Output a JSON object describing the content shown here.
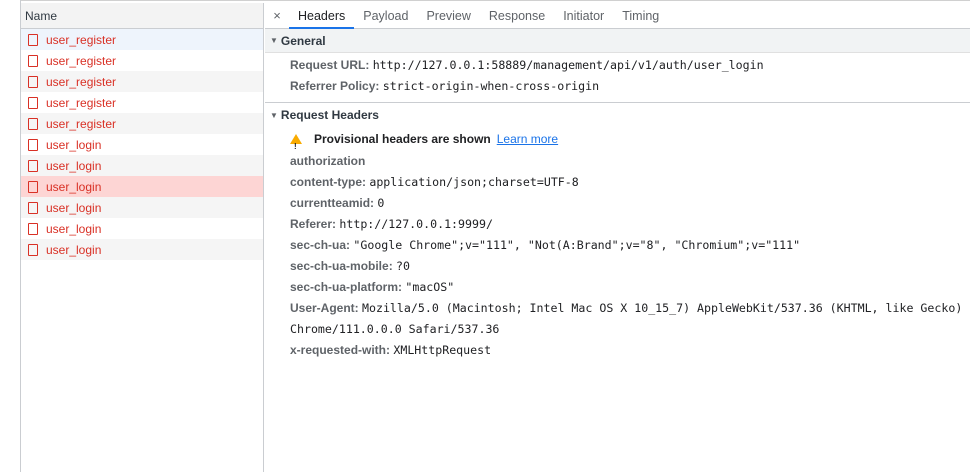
{
  "request_list": {
    "header": "Name",
    "items": [
      {
        "label": "user_register",
        "state": "first"
      },
      {
        "label": "user_register",
        "state": "normal"
      },
      {
        "label": "user_register",
        "state": "alt"
      },
      {
        "label": "user_register",
        "state": "normal"
      },
      {
        "label": "user_register",
        "state": "alt"
      },
      {
        "label": "user_login",
        "state": "normal"
      },
      {
        "label": "user_login",
        "state": "alt"
      },
      {
        "label": "user_login",
        "state": "selected"
      },
      {
        "label": "user_login",
        "state": "alt"
      },
      {
        "label": "user_login",
        "state": "normal"
      },
      {
        "label": "user_login",
        "state": "alt"
      }
    ]
  },
  "tabs": {
    "close": "×",
    "items": [
      "Headers",
      "Payload",
      "Preview",
      "Response",
      "Initiator",
      "Timing"
    ],
    "active": "Headers"
  },
  "general": {
    "title": "General",
    "rows": [
      {
        "key": "Request URL:",
        "value": "http://127.0.0.1:58889/management/api/v1/auth/user_login"
      },
      {
        "key": "Referrer Policy:",
        "value": "strict-origin-when-cross-origin"
      }
    ]
  },
  "request_headers": {
    "title": "Request Headers",
    "warning": {
      "text": "Provisional headers are shown",
      "link": "Learn more"
    },
    "rows": [
      {
        "key": "authorization",
        "value": ""
      },
      {
        "key": "content-type:",
        "value": "application/json;charset=UTF-8"
      },
      {
        "key": "currentteamid:",
        "value": "0"
      },
      {
        "key": "Referer:",
        "value": "http://127.0.0.1:9999/"
      },
      {
        "key": "sec-ch-ua:",
        "value": "\"Google Chrome\";v=\"111\", \"Not(A:Brand\";v=\"8\", \"Chromium\";v=\"111\""
      },
      {
        "key": "sec-ch-ua-mobile:",
        "value": "?0"
      },
      {
        "key": "sec-ch-ua-platform:",
        "value": "\"macOS\""
      },
      {
        "key": "User-Agent:",
        "value": "Mozilla/5.0 (Macintosh; Intel Mac OS X 10_15_7) AppleWebKit/537.36 (KHTML, like Gecko) Chrome/111.0.0.0 Safari/537.36"
      },
      {
        "key": "x-requested-with:",
        "value": "XMLHttpRequest"
      }
    ]
  },
  "colors": {
    "accent": "#1a73e8",
    "error_text": "#d93025",
    "selected_row": "#fdd5d4",
    "warning": "#f9ab00"
  },
  "icons": {
    "request_item": "document-icon",
    "warning": "warning-triangle-icon",
    "collapse": "triangle-down-icon",
    "close": "close-icon"
  }
}
